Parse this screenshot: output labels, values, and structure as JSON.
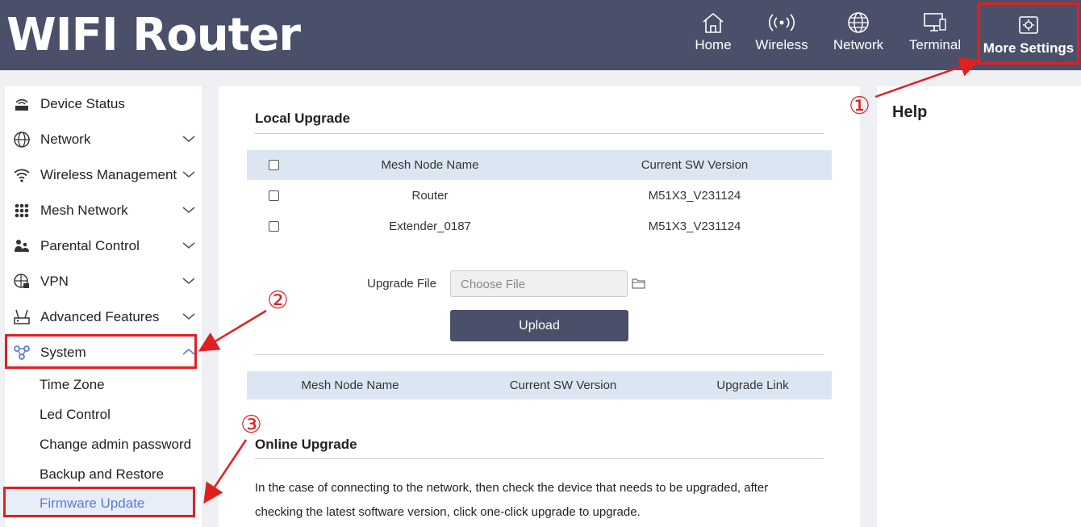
{
  "app": {
    "title": "WIFI Router"
  },
  "nav": [
    {
      "label": "Home",
      "icon": "home-icon"
    },
    {
      "label": "Wireless",
      "icon": "wireless-signal-icon"
    },
    {
      "label": "Network",
      "icon": "globe-icon"
    },
    {
      "label": "Terminal",
      "icon": "monitor-icon"
    },
    {
      "label": "More Settings",
      "icon": "settings-icon",
      "active": true
    }
  ],
  "sidebar": {
    "items": [
      {
        "label": "Device Status",
        "icon": "router-status-icon",
        "expandable": false
      },
      {
        "label": "Network",
        "icon": "globe-icon",
        "expandable": true
      },
      {
        "label": "Wireless Management",
        "icon": "wifi-icon",
        "expandable": true
      },
      {
        "label": "Mesh Network",
        "icon": "mesh-grid-icon",
        "expandable": true
      },
      {
        "label": "Parental Control",
        "icon": "parental-icon",
        "expandable": true
      },
      {
        "label": "VPN",
        "icon": "vpn-globe-icon",
        "expandable": true
      },
      {
        "label": "Advanced Features",
        "icon": "router-advanced-icon",
        "expandable": true
      },
      {
        "label": "System",
        "icon": "system-nodes-icon",
        "expandable": true,
        "expanded": true
      }
    ],
    "system_subitems": [
      {
        "label": "Time Zone"
      },
      {
        "label": "Led Control"
      },
      {
        "label": "Change admin password"
      },
      {
        "label": "Backup and Restore"
      },
      {
        "label": "Firmware Update",
        "active": true
      }
    ]
  },
  "local_upgrade": {
    "title": "Local Upgrade",
    "columns": [
      "Mesh Node Name",
      "Current SW Version"
    ],
    "rows": [
      {
        "name": "Router",
        "version": "M51X3_V231124"
      },
      {
        "name": "Extender_0187",
        "version": "M51X3_V231124"
      }
    ],
    "upgrade_file_label": "Upgrade File",
    "file_placeholder": "Choose File",
    "upload_label": "Upload",
    "link_table_columns": [
      "Mesh Node Name",
      "Current SW Version",
      "Upgrade Link"
    ]
  },
  "online_upgrade": {
    "title": "Online Upgrade",
    "description_line1": "In the case of connecting to the network, then check the device that needs to be upgraded, after",
    "description_line2": "checking the latest software version, click one-click upgrade to upgrade."
  },
  "help": {
    "title": "Help"
  },
  "annotations": [
    "①",
    "②",
    "③"
  ],
  "colors": {
    "header": "#4a5069",
    "accent": "#5b7bd5",
    "highlight": "#e02020",
    "table_header": "#dce6f3"
  }
}
